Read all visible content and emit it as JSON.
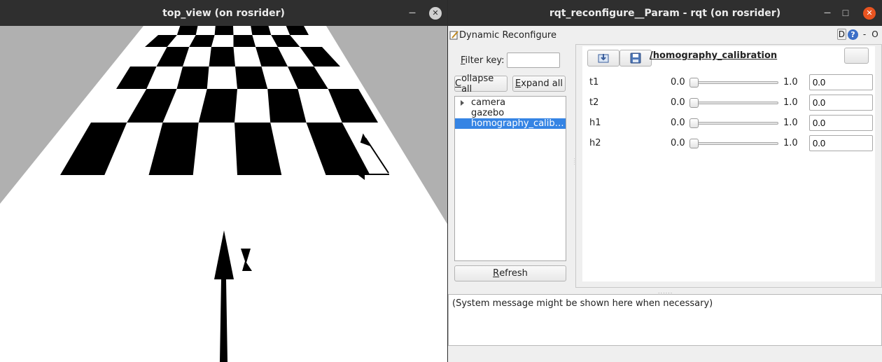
{
  "left_window": {
    "title": "top_view (on rosrider)",
    "minimize_glyph": "—",
    "close_glyph": "✕"
  },
  "right_window": {
    "title": "rqt_reconfigure__Param - rqt (on rosrider)",
    "minimize_glyph": "—",
    "maximize_glyph": "☐",
    "close_glyph": "✕",
    "plugin": {
      "title": "Dynamic Reconfigure",
      "tools": {
        "d": "D",
        "help": "?",
        "minus": "-",
        "o": "O"
      }
    },
    "filter": {
      "label_prefix": "F",
      "label_rest": "ilter key:",
      "value": ""
    },
    "collapse_all": {
      "u": "C",
      "rest": "ollapse all"
    },
    "expand_all": {
      "u": "E",
      "rest": "xpand all"
    },
    "tree": [
      {
        "label": "camera",
        "expandable": true,
        "selected": false
      },
      {
        "label": "gazebo",
        "expandable": false,
        "selected": false
      },
      {
        "label": "homography_calibration",
        "expandable": false,
        "selected": true
      }
    ],
    "refresh": {
      "u": "R",
      "rest": "efresh"
    },
    "node_title": "/homography_calibration",
    "params": [
      {
        "name": "t1",
        "min": "0.0",
        "max": "1.0",
        "value": "0.0",
        "fraction": 0.0
      },
      {
        "name": "t2",
        "min": "0.0",
        "max": "1.0",
        "value": "0.0",
        "fraction": 0.0
      },
      {
        "name": "h1",
        "min": "0.0",
        "max": "1.0",
        "value": "0.0",
        "fraction": 0.0
      },
      {
        "name": "h2",
        "min": "0.0",
        "max": "1.0",
        "value": "0.0",
        "fraction": 0.0
      }
    ],
    "system_message": "(System message might be shown here when necessary)"
  },
  "colors": {
    "titlebar": "#2f2f2f",
    "close_active": "#e95420",
    "selection": "#3584e4",
    "floor": "#b0b0b0"
  }
}
